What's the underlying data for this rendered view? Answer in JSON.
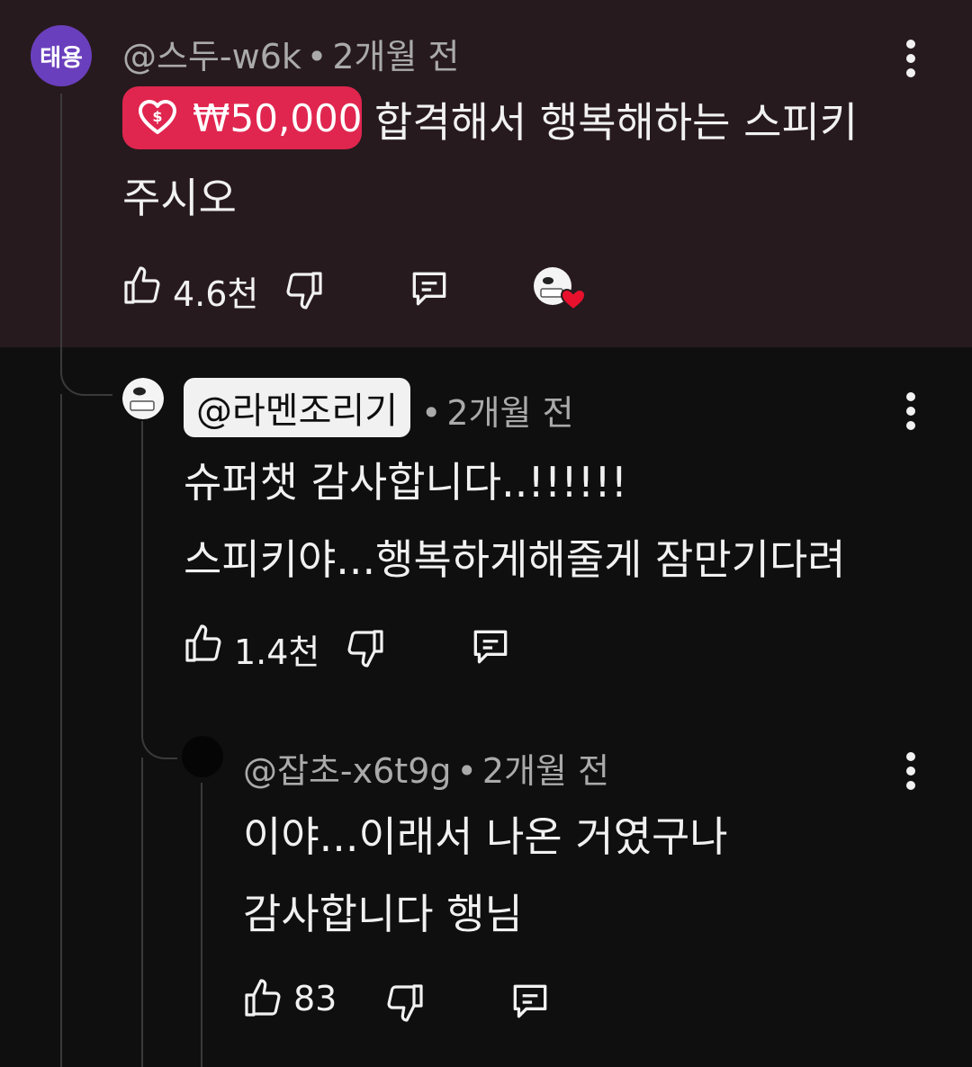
{
  "comments": [
    {
      "avatar_text": "태용",
      "handle": "@스두-w6k",
      "time": "2개월 전",
      "superchat_amount": "₩50,000",
      "text_line1": "합격해서 행복해하는 스피키",
      "text_line2": "주시오",
      "likes": "4.6천"
    },
    {
      "handle": "@라멘조리기",
      "time": "2개월 전",
      "text_line1": "슈퍼챗 감사합니다..!!!!!!",
      "text_line2": "스피키야...행복하게해줄게 잠만기다려",
      "likes": "1.4천"
    },
    {
      "handle": "@잡초-x6t9g",
      "time": "2개월 전",
      "text_line1": "이야...이래서 나온 거였구나",
      "text_line2": "감사합니다 행님",
      "likes": "83"
    }
  ],
  "separator": "•",
  "colors": {
    "background": "#0f0f0f",
    "highlight_background": "#271a1e",
    "superchat": "#e0264f",
    "avatar": "#6a3fbd",
    "heart": "#e8112d"
  },
  "icons": [
    "like-icon",
    "dislike-icon",
    "reply-icon",
    "more-vert-icon",
    "creator-heart-icon",
    "money-heart-icon"
  ]
}
